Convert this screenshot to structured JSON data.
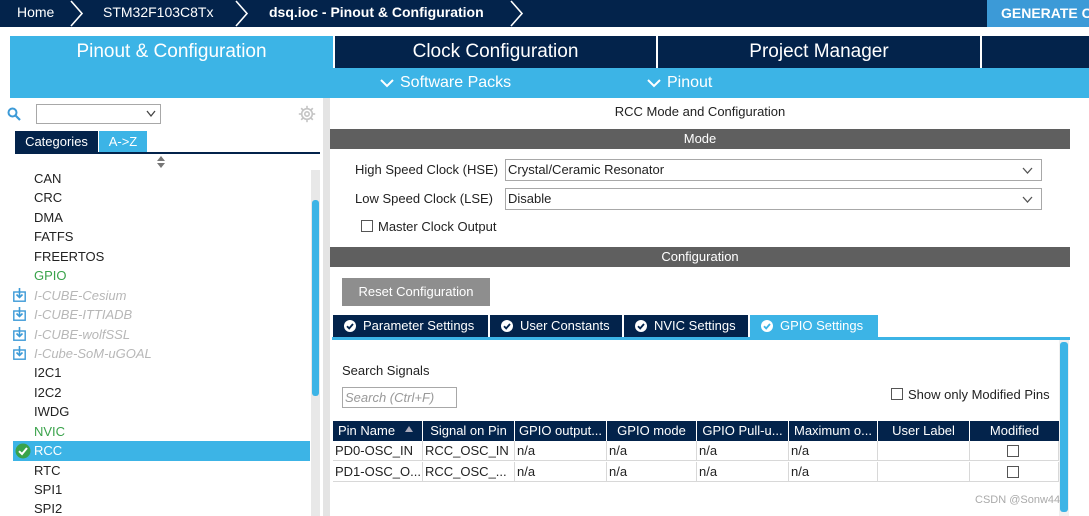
{
  "breadcrumb": {
    "home": "Home",
    "mcu": "STM32F103C8Tx",
    "file": "dsq.ioc - Pinout & Configuration",
    "generate": "GENERATE CODE"
  },
  "main_tabs": {
    "pinout": "Pinout & Configuration",
    "clock": "Clock Configuration",
    "project": "Project Manager"
  },
  "subbar": {
    "software_packs": "Software Packs",
    "pinout": "Pinout"
  },
  "left": {
    "search_value": "",
    "tabs": {
      "categories": "Categories",
      "atoz": "A->Z"
    },
    "items": [
      {
        "label": "CAN"
      },
      {
        "label": "CRC"
      },
      {
        "label": "DMA"
      },
      {
        "label": "FATFS"
      },
      {
        "label": "FREERTOS"
      },
      {
        "label": "GPIO"
      },
      {
        "label": "I-CUBE-Cesium"
      },
      {
        "label": "I-CUBE-ITTIADB"
      },
      {
        "label": "I-CUBE-wolfSSL"
      },
      {
        "label": "I-Cube-SoM-uGOAL"
      },
      {
        "label": "I2C1"
      },
      {
        "label": "I2C2"
      },
      {
        "label": "IWDG"
      },
      {
        "label": "NVIC"
      },
      {
        "label": "RCC"
      },
      {
        "label": "RTC"
      },
      {
        "label": "SPI1"
      },
      {
        "label": "SPI2"
      }
    ]
  },
  "rcc": {
    "title": "RCC Mode and Configuration",
    "mode_header": "Mode",
    "hse_label": "High Speed Clock (HSE)",
    "hse_value": "Crystal/Ceramic Resonator",
    "lse_label": "Low Speed Clock (LSE)",
    "lse_value": "Disable",
    "mco_label": "Master Clock Output",
    "config_header": "Configuration",
    "reset_button": "Reset Configuration",
    "tabs": {
      "parameter": "Parameter Settings",
      "user_constants": "User Constants",
      "nvic": "NVIC Settings",
      "gpio": "GPIO Settings"
    },
    "search_signals_label": "Search Signals",
    "search_signals_placeholder": "Search (Ctrl+F)",
    "show_modified_label": "Show only Modified Pins",
    "table": {
      "headers": [
        "Pin Name",
        "Signal on Pin",
        "GPIO output...",
        "GPIO mode",
        "GPIO Pull-u...",
        "Maximum o...",
        "User Label",
        "Modified"
      ],
      "rows": [
        [
          "PD0-OSC_IN",
          "RCC_OSC_IN",
          "n/a",
          "n/a",
          "n/a",
          "n/a",
          "",
          ""
        ],
        [
          "PD1-OSC_O...",
          "RCC_OSC_...",
          "n/a",
          "n/a",
          "n/a",
          "n/a",
          "",
          ""
        ]
      ]
    }
  },
  "watermark": "CSDN @Sonw44",
  "colors": {
    "navy": "#03234b",
    "accent": "#3cb4e6",
    "green": "#3aa34b",
    "section_gray": "#5f5f5f"
  }
}
